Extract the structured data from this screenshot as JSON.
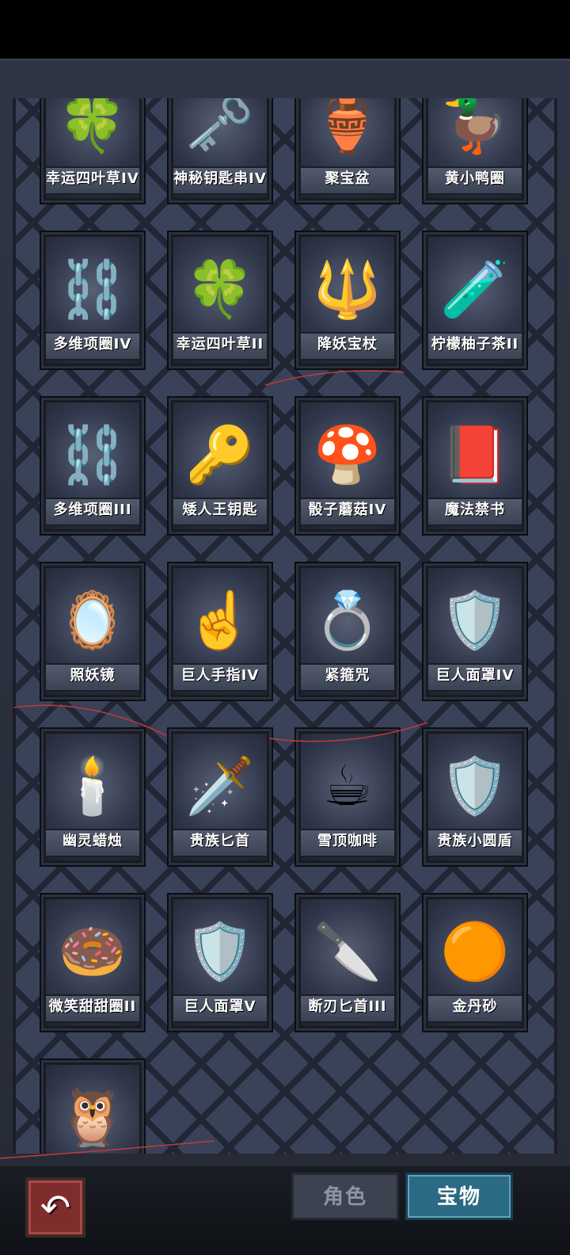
{
  "tabs": {
    "role": "角色",
    "treasure": "宝物"
  },
  "back_icon": "back-arrow-icon",
  "accent_color": "#2b6a84",
  "items": [
    {
      "name": "幸运四叶草IV",
      "icon": "clover-icon",
      "glyph": "🍀"
    },
    {
      "name": "神秘钥匙串IV",
      "icon": "keys-icon",
      "glyph": "🗝️"
    },
    {
      "name": "聚宝盆",
      "icon": "treasure-bowl-icon",
      "glyph": "🏺"
    },
    {
      "name": "黄小鸭圈",
      "icon": "duck-ring-icon",
      "glyph": "🦆"
    },
    {
      "name": "多维项圈IV",
      "icon": "spiked-collar-icon",
      "glyph": "⛓️"
    },
    {
      "name": "幸运四叶草II",
      "icon": "clover-icon",
      "glyph": "🍀"
    },
    {
      "name": "降妖宝杖",
      "icon": "staff-icon",
      "glyph": "🔱"
    },
    {
      "name": "柠檬柚子茶II",
      "icon": "potion-icon",
      "glyph": "🧪"
    },
    {
      "name": "多维项圈III",
      "icon": "spiked-collar-icon",
      "glyph": "⛓️"
    },
    {
      "name": "矮人王钥匙",
      "icon": "key-icon",
      "glyph": "🔑"
    },
    {
      "name": "骰子蘑菇IV",
      "icon": "mushroom-icon",
      "glyph": "🍄"
    },
    {
      "name": "魔法禁书",
      "icon": "book-icon",
      "glyph": "📕"
    },
    {
      "name": "照妖镜",
      "icon": "mirror-icon",
      "glyph": "🪞"
    },
    {
      "name": "巨人手指IV",
      "icon": "finger-icon",
      "glyph": "☝️"
    },
    {
      "name": "紧箍咒",
      "icon": "ring-icon",
      "glyph": "💍"
    },
    {
      "name": "巨人面罩IV",
      "icon": "mask-icon",
      "glyph": "🛡️"
    },
    {
      "name": "幽灵蜡烛",
      "icon": "candle-icon",
      "glyph": "🕯️"
    },
    {
      "name": "贵族匕首",
      "icon": "dagger-icon",
      "glyph": "🗡️"
    },
    {
      "name": "雪顶咖啡",
      "icon": "coffee-icon",
      "glyph": "☕"
    },
    {
      "name": "贵族小圆盾",
      "icon": "shield-icon",
      "glyph": "🛡️"
    },
    {
      "name": "微笑甜甜圈II",
      "icon": "donut-icon",
      "glyph": "🍩"
    },
    {
      "name": "巨人面罩V",
      "icon": "mask-icon",
      "glyph": "🛡️"
    },
    {
      "name": "断刃匕首III",
      "icon": "broken-dagger-icon",
      "glyph": "🔪"
    },
    {
      "name": "金丹砂",
      "icon": "golden-orbs-icon",
      "glyph": "🟠"
    },
    {
      "name": "",
      "icon": "owl-icon",
      "glyph": "🦉"
    }
  ]
}
